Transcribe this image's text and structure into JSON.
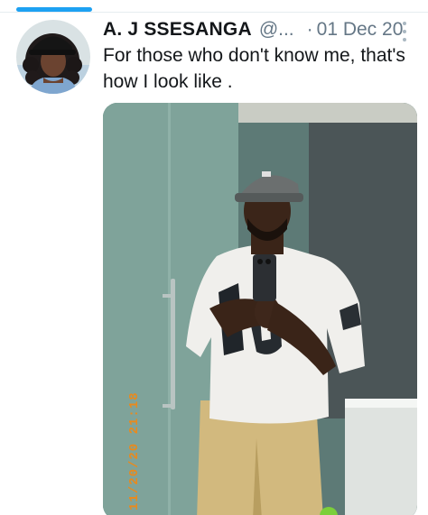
{
  "tweet": {
    "display_name": "A. J SSESANGA",
    "handle": "@...",
    "separator": "·",
    "date": "01 Dec 20",
    "text": "For those who don't know me, that's how I look like .",
    "photo_timestamp": "11/20/20 21:18"
  },
  "colors": {
    "accent": "#1da1f2",
    "name_text": "#14171a",
    "meta_text": "#657786"
  },
  "icons": {
    "more": "more-vertical-icon"
  }
}
